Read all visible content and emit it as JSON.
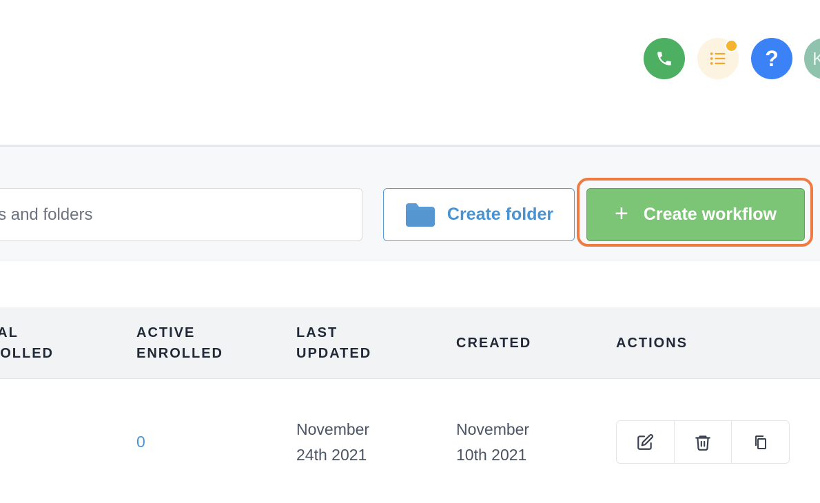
{
  "header": {
    "phone_icon": "phone-icon",
    "tasks_icon": "list-icon",
    "help_label": "?",
    "avatar_initial": "K"
  },
  "toolbar": {
    "search_placeholder": "Search workflows and folders",
    "create_folder_label": "Create folder",
    "create_workflow_plus": "+",
    "create_workflow_label": "Create workflow"
  },
  "table": {
    "columns": {
      "total_enrolled": [
        "TOTAL",
        "ENROLLED"
      ],
      "active_enrolled": [
        "ACTIVE",
        "ENROLLED"
      ],
      "last_updated": [
        "LAST",
        "UPDATED"
      ],
      "created": "CREATED",
      "actions": "ACTIONS"
    },
    "rows": [
      {
        "active_enrolled": "0",
        "last_updated": [
          "November",
          "24th 2021"
        ],
        "created": [
          "November",
          "10th 2021"
        ]
      }
    ]
  },
  "colors": {
    "accent_green": "#7cc576",
    "accent_blue": "#4a93d1",
    "highlight": "#f07a42"
  }
}
